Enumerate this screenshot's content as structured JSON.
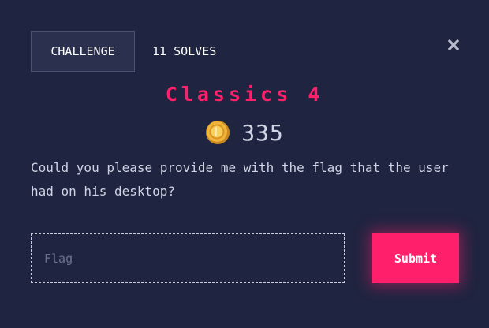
{
  "tabs": {
    "challenge_label": "CHALLENGE",
    "solves_label": "11 SOLVES"
  },
  "challenge": {
    "title": "Classics 4",
    "points": "335",
    "description": "Could you please provide me with the flag that the user had on his desktop?"
  },
  "form": {
    "flag_placeholder": "Flag",
    "flag_value": "",
    "submit_label": "Submit"
  },
  "icons": {
    "close": "close-icon",
    "coin": "coin-icon"
  },
  "colors": {
    "background": "#1f2440",
    "accent": "#ff1f6b",
    "coin": "#f0b43a"
  }
}
